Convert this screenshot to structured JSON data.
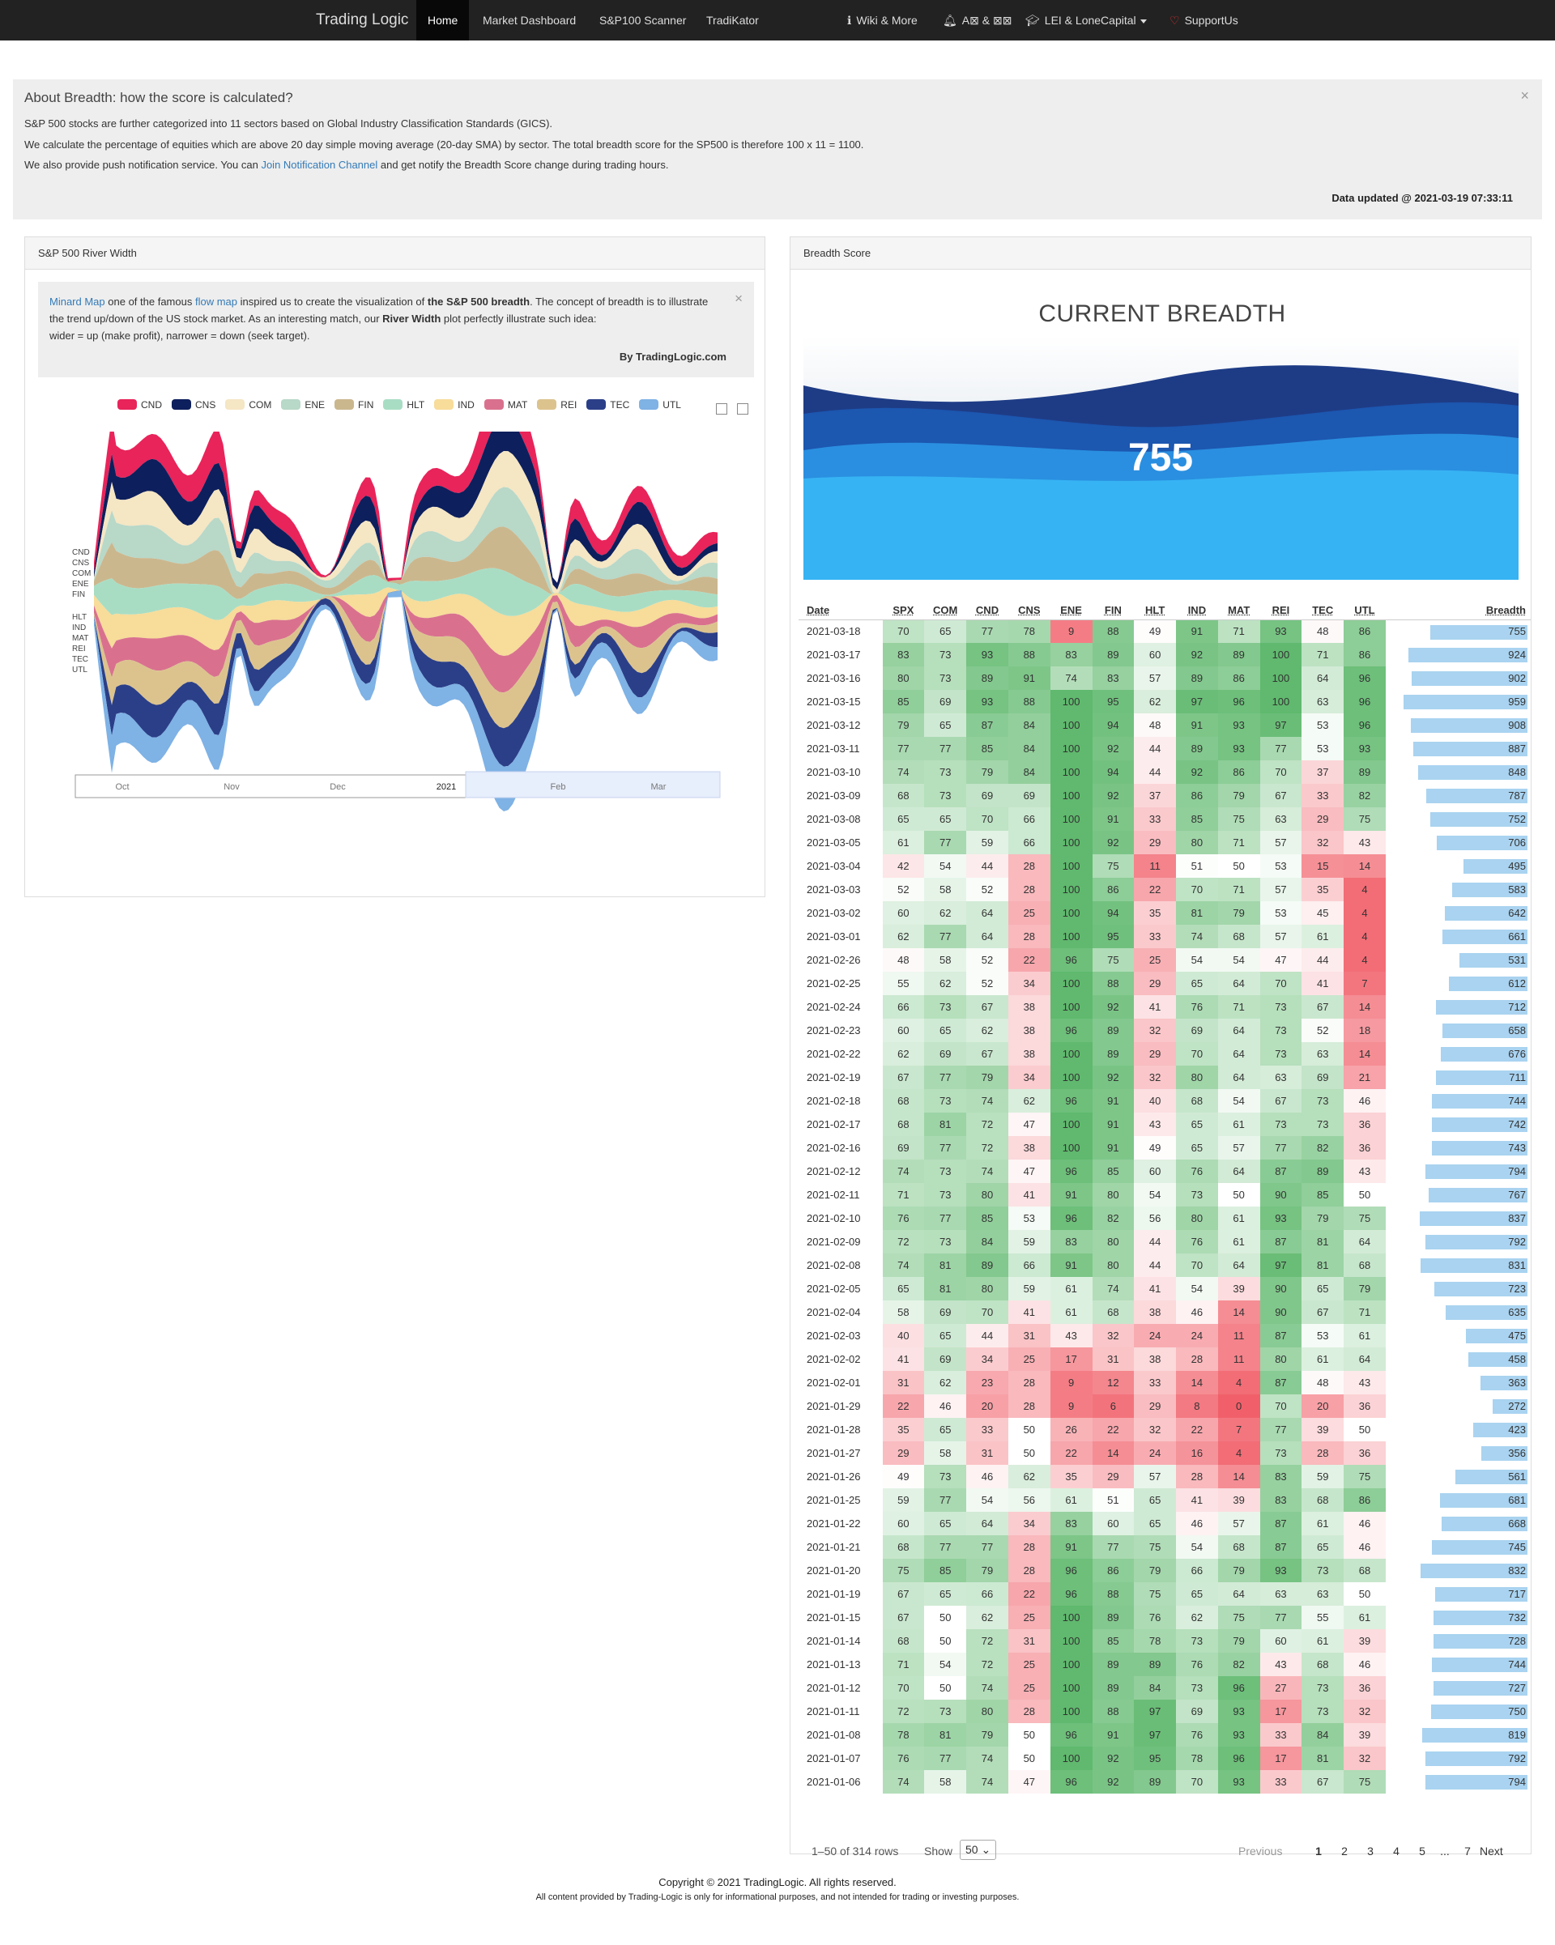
{
  "nav": {
    "brand": "Trading Logic",
    "home": "Home",
    "market": "Market Dashboard",
    "scanner": "S&P100 Scanner",
    "tradikator": "TradiKator",
    "wiki": "Wiki & More",
    "alerts": "A⊠ & ⊠⊠",
    "lei": "LEI & LoneCapital",
    "support": "SupportUs"
  },
  "about": {
    "title": "About Breadth: how the score is calculated?",
    "line1": "S&P 500 stocks are further categorized into 11 sectors based on Global Industry Classification Standards (GICS).",
    "line2": "We calculate the percentage of equities which are above 20 day simple moving average (20-day SMA) by sector. The total breadth score for the SP500 is therefore 100 x 11 = 1100.",
    "line3a": "We also provide push notification service. You can",
    "line3link": "Join Notification Channel",
    "line3b": "and get notify the Breadth Score change during trading hours.",
    "updated": "Data updated @ 2021-03-19 07:33:11",
    "close": "×"
  },
  "river": {
    "panel_title": "S&P 500 River Width",
    "minard_link": "Minard Map",
    "t1": "one of the famous",
    "flow_link": "flow map",
    "t2": "inspired us to create the visualization of",
    "bold1": "the S&P 500 breadth",
    "t3": ". The concept of breadth is to illustrate the trend up/down of the US stock market. As an interesting match, our",
    "bold2": "River Width",
    "t4": "plot perfectly illustrate such idea:",
    "t5": "wider = up (make profit), narrower = down (seek target).",
    "by": "By TradingLogic.com",
    "close": "×",
    "xlabels": [
      "Oct",
      "Nov",
      "Dec",
      "2021",
      "Feb",
      "Mar"
    ]
  },
  "chart_data": {
    "type": "area",
    "title": "",
    "series_names": [
      "CND",
      "CNS",
      "COM",
      "ENE",
      "FIN",
      "HLT",
      "IND",
      "MAT",
      "REI",
      "TEC",
      "UTL"
    ],
    "colors": [
      "#e8245a",
      "#0d1f5c",
      "#f5e6c4",
      "#b8d8c8",
      "#cbb78e",
      "#a8ddc4",
      "#f7dc9a",
      "#d9718e",
      "#dcc38e",
      "#2b3f88",
      "#7fb2e5"
    ]
  },
  "breadth": {
    "panel_title": "Breadth Score",
    "current_title": "CURRENT BREADTH",
    "current_value": "755",
    "columns": [
      "Date",
      "SPX",
      "COM",
      "CND",
      "CNS",
      "ENE",
      "FIN",
      "HLT",
      "IND",
      "MAT",
      "REI",
      "TEC",
      "UTL",
      "Breadth"
    ],
    "rows": [
      [
        "2021-03-18",
        70,
        65,
        77,
        78,
        9,
        88,
        49,
        91,
        71,
        93,
        48,
        86,
        755
      ],
      [
        "2021-03-17",
        83,
        73,
        93,
        88,
        83,
        89,
        60,
        92,
        89,
        100,
        71,
        86,
        924
      ],
      [
        "2021-03-16",
        80,
        73,
        89,
        91,
        74,
        83,
        57,
        89,
        86,
        100,
        64,
        96,
        902
      ],
      [
        "2021-03-15",
        85,
        69,
        93,
        88,
        100,
        95,
        62,
        97,
        96,
        100,
        63,
        96,
        959
      ],
      [
        "2021-03-12",
        79,
        65,
        87,
        84,
        100,
        94,
        48,
        91,
        93,
        97,
        53,
        96,
        908
      ],
      [
        "2021-03-11",
        77,
        77,
        85,
        84,
        100,
        92,
        44,
        89,
        93,
        77,
        53,
        93,
        887
      ],
      [
        "2021-03-10",
        74,
        73,
        79,
        84,
        100,
        94,
        44,
        92,
        86,
        70,
        37,
        89,
        848
      ],
      [
        "2021-03-09",
        68,
        73,
        69,
        69,
        100,
        92,
        37,
        86,
        79,
        67,
        33,
        82,
        787
      ],
      [
        "2021-03-08",
        65,
        65,
        70,
        66,
        100,
        91,
        33,
        85,
        75,
        63,
        29,
        75,
        752
      ],
      [
        "2021-03-05",
        61,
        77,
        59,
        66,
        100,
        92,
        29,
        80,
        71,
        57,
        32,
        43,
        706
      ],
      [
        "2021-03-04",
        42,
        54,
        44,
        28,
        100,
        75,
        11,
        51,
        50,
        53,
        15,
        14,
        495
      ],
      [
        "2021-03-03",
        52,
        58,
        52,
        28,
        100,
        86,
        22,
        70,
        71,
        57,
        35,
        4,
        583
      ],
      [
        "2021-03-02",
        60,
        62,
        64,
        25,
        100,
        94,
        35,
        81,
        79,
        53,
        45,
        4,
        642
      ],
      [
        "2021-03-01",
        62,
        77,
        64,
        28,
        100,
        95,
        33,
        74,
        68,
        57,
        61,
        4,
        661
      ],
      [
        "2021-02-26",
        48,
        58,
        52,
        22,
        96,
        75,
        25,
        54,
        54,
        47,
        44,
        4,
        531
      ],
      [
        "2021-02-25",
        55,
        62,
        52,
        34,
        100,
        88,
        29,
        65,
        64,
        70,
        41,
        7,
        612
      ],
      [
        "2021-02-24",
        66,
        73,
        67,
        38,
        100,
        92,
        41,
        76,
        71,
        73,
        67,
        14,
        712
      ],
      [
        "2021-02-23",
        60,
        65,
        62,
        38,
        96,
        89,
        32,
        69,
        64,
        73,
        52,
        18,
        658
      ],
      [
        "2021-02-22",
        62,
        69,
        67,
        38,
        100,
        89,
        29,
        70,
        64,
        73,
        63,
        14,
        676
      ],
      [
        "2021-02-19",
        67,
        77,
        79,
        34,
        100,
        92,
        32,
        80,
        64,
        63,
        69,
        21,
        711
      ],
      [
        "2021-02-18",
        68,
        73,
        74,
        62,
        96,
        91,
        40,
        68,
        54,
        67,
        73,
        46,
        744
      ],
      [
        "2021-02-17",
        68,
        81,
        72,
        47,
        100,
        91,
        43,
        65,
        61,
        73,
        73,
        36,
        742
      ],
      [
        "2021-02-16",
        69,
        77,
        72,
        38,
        100,
        91,
        49,
        65,
        57,
        77,
        82,
        36,
        743
      ],
      [
        "2021-02-12",
        74,
        73,
        74,
        47,
        96,
        85,
        60,
        76,
        64,
        87,
        89,
        43,
        794
      ],
      [
        "2021-02-11",
        71,
        73,
        80,
        41,
        91,
        80,
        54,
        73,
        50,
        90,
        85,
        50,
        767
      ],
      [
        "2021-02-10",
        76,
        77,
        85,
        53,
        96,
        82,
        56,
        80,
        61,
        93,
        79,
        75,
        837
      ],
      [
        "2021-02-09",
        72,
        73,
        84,
        59,
        83,
        80,
        44,
        76,
        61,
        87,
        81,
        64,
        792
      ],
      [
        "2021-02-08",
        74,
        81,
        89,
        66,
        91,
        80,
        44,
        70,
        64,
        97,
        81,
        68,
        831
      ],
      [
        "2021-02-05",
        65,
        81,
        80,
        59,
        61,
        74,
        41,
        54,
        39,
        90,
        65,
        79,
        723
      ],
      [
        "2021-02-04",
        58,
        69,
        70,
        41,
        61,
        68,
        38,
        46,
        14,
        90,
        67,
        71,
        635
      ],
      [
        "2021-02-03",
        40,
        65,
        44,
        31,
        43,
        32,
        24,
        24,
        11,
        87,
        53,
        61,
        475
      ],
      [
        "2021-02-02",
        41,
        69,
        34,
        25,
        17,
        31,
        38,
        28,
        11,
        80,
        61,
        64,
        458
      ],
      [
        "2021-02-01",
        31,
        62,
        23,
        28,
        9,
        12,
        33,
        14,
        4,
        87,
        48,
        43,
        363
      ],
      [
        "2021-01-29",
        22,
        46,
        20,
        28,
        9,
        6,
        29,
        8,
        0,
        70,
        20,
        36,
        272
      ],
      [
        "2021-01-28",
        35,
        65,
        33,
        50,
        26,
        22,
        32,
        22,
        7,
        77,
        39,
        50,
        423
      ],
      [
        "2021-01-27",
        29,
        58,
        31,
        50,
        22,
        14,
        24,
        16,
        4,
        73,
        28,
        36,
        356
      ],
      [
        "2021-01-26",
        49,
        73,
        46,
        62,
        35,
        29,
        57,
        28,
        14,
        83,
        59,
        75,
        561
      ],
      [
        "2021-01-25",
        59,
        77,
        54,
        56,
        61,
        51,
        65,
        41,
        39,
        83,
        68,
        86,
        681
      ],
      [
        "2021-01-22",
        60,
        65,
        64,
        34,
        83,
        60,
        65,
        46,
        57,
        87,
        61,
        46,
        668
      ],
      [
        "2021-01-21",
        68,
        77,
        77,
        28,
        91,
        77,
        75,
        54,
        68,
        87,
        65,
        46,
        745
      ],
      [
        "2021-01-20",
        75,
        85,
        79,
        28,
        96,
        86,
        79,
        66,
        79,
        93,
        73,
        68,
        832
      ],
      [
        "2021-01-19",
        67,
        65,
        66,
        22,
        96,
        88,
        75,
        65,
        64,
        63,
        63,
        50,
        717
      ],
      [
        "2021-01-15",
        67,
        50,
        62,
        25,
        100,
        89,
        76,
        62,
        75,
        77,
        55,
        61,
        732
      ],
      [
        "2021-01-14",
        68,
        50,
        72,
        31,
        100,
        85,
        78,
        73,
        79,
        60,
        61,
        39,
        728
      ],
      [
        "2021-01-13",
        71,
        54,
        72,
        25,
        100,
        89,
        89,
        76,
        82,
        43,
        68,
        46,
        744
      ],
      [
        "2021-01-12",
        70,
        50,
        74,
        25,
        100,
        89,
        84,
        73,
        96,
        27,
        73,
        36,
        727
      ],
      [
        "2021-01-11",
        72,
        73,
        80,
        28,
        100,
        88,
        97,
        69,
        93,
        17,
        73,
        32,
        750
      ],
      [
        "2021-01-08",
        78,
        81,
        79,
        50,
        96,
        91,
        97,
        76,
        93,
        33,
        84,
        39,
        819
      ],
      [
        "2021-01-07",
        76,
        77,
        74,
        50,
        100,
        92,
        95,
        78,
        96,
        17,
        81,
        32,
        792
      ],
      [
        "2021-01-06",
        74,
        58,
        74,
        47,
        96,
        92,
        89,
        70,
        93,
        33,
        67,
        75,
        794
      ]
    ],
    "pager": {
      "info": "1–50 of 314 rows",
      "show": "Show",
      "per_page": "50",
      "prev": "Previous",
      "pages": [
        "1",
        "2",
        "3",
        "4",
        "5",
        "...",
        "7"
      ],
      "next": "Next"
    }
  },
  "footer": {
    "copyright": "Copyright © 2021 TradingLogic. All rights reserved.",
    "disclaimer": "All content provided by Trading-Logic is only for informational purposes, and not intended for trading or investing purposes."
  }
}
